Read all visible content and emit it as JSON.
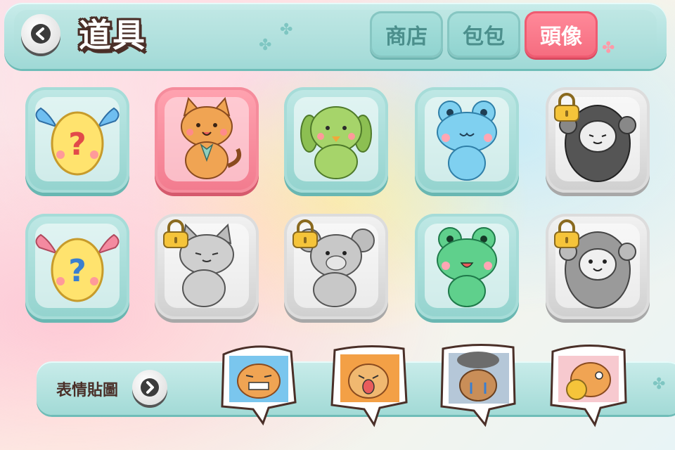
{
  "header": {
    "title": "道具",
    "tabs": [
      {
        "label": "商店",
        "active": false
      },
      {
        "label": "包包",
        "active": false
      },
      {
        "label": "頭像",
        "active": true
      }
    ]
  },
  "avatars": [
    {
      "name": "mystery-egg-blue",
      "color": "#5fb6ee",
      "locked": false,
      "selected": false
    },
    {
      "name": "orange-cat",
      "color": "#f0a453",
      "locked": false,
      "selected": true
    },
    {
      "name": "green-dog",
      "color": "#9ccc64",
      "locked": false,
      "selected": false
    },
    {
      "name": "blue-frog",
      "color": "#7fd0f0",
      "locked": false,
      "selected": false
    },
    {
      "name": "black-sheep",
      "color": "#555555",
      "locked": true,
      "selected": false
    },
    {
      "name": "mystery-egg-pink",
      "color": "#f48aa0",
      "locked": false,
      "selected": false
    },
    {
      "name": "grey-cat",
      "color": "#aaaaaa",
      "locked": true,
      "selected": false
    },
    {
      "name": "grey-bear",
      "color": "#a8a8a8",
      "locked": true,
      "selected": false
    },
    {
      "name": "green-frog",
      "color": "#5fd08c",
      "locked": false,
      "selected": false
    },
    {
      "name": "grey-sheep",
      "color": "#9a9a9a",
      "locked": true,
      "selected": false
    }
  ],
  "emoticons": {
    "label": "表情貼圖",
    "stickers": [
      "cat-grin",
      "cat-shout",
      "cat-rain-cry",
      "cat-money"
    ]
  },
  "colors": {
    "accent": "#f56c7f",
    "panel": "#a7dcd9",
    "title_outline": "#4a2f28"
  }
}
